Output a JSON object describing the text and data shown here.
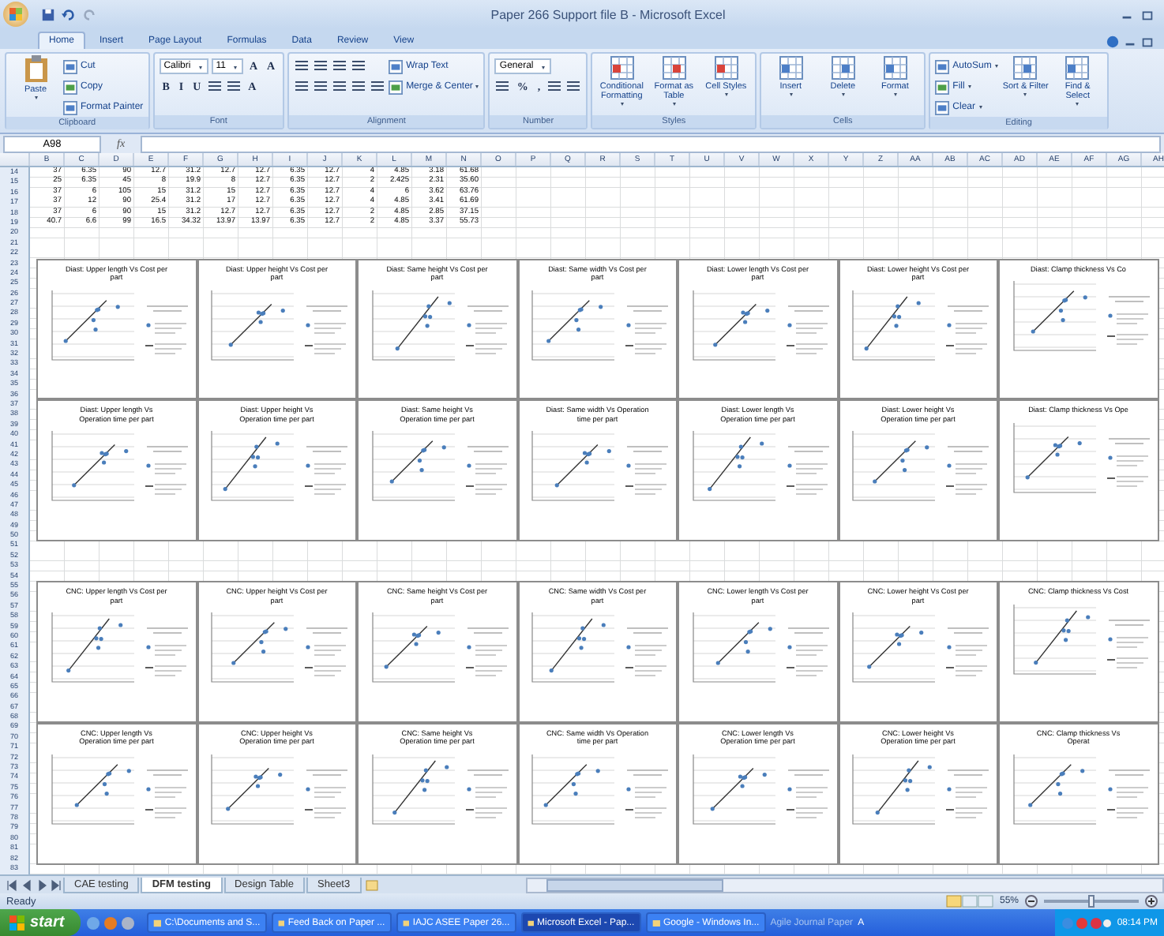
{
  "window": {
    "title": "Paper 266 Support file B - Microsoft Excel"
  },
  "ribbon": {
    "tabs": [
      {
        "label": "Home",
        "selected": true
      },
      {
        "label": "Insert",
        "selected": false
      },
      {
        "label": "Page Layout",
        "selected": false
      },
      {
        "label": "Formulas",
        "selected": false
      },
      {
        "label": "Data",
        "selected": false
      },
      {
        "label": "Review",
        "selected": false
      },
      {
        "label": "View",
        "selected": false
      }
    ],
    "groups": [
      {
        "label": "Clipboard",
        "items": [
          {
            "kind": "large",
            "label": "Paste",
            "dropdown": true
          },
          {
            "kind": "stack",
            "rows": [
              {
                "controls": [
                  {
                    "kind": "small",
                    "label": "Cut"
                  }
                ]
              },
              {
                "controls": [
                  {
                    "kind": "small",
                    "label": "Copy"
                  }
                ]
              },
              {
                "controls": [
                  {
                    "kind": "small",
                    "label": "Format Painter"
                  }
                ]
              }
            ]
          }
        ]
      },
      {
        "label": "Font",
        "items": [
          {
            "kind": "stack",
            "rows": [
              {
                "controls": [
                  {
                    "kind": "field",
                    "label": "Calibri"
                  },
                  {
                    "kind": "field",
                    "label": "11"
                  },
                  {
                    "kind": "glyph",
                    "label": "A"
                  },
                  {
                    "kind": "glyph",
                    "label": "A"
                  }
                ]
              },
              {
                "controls": [
                  {
                    "kind": "glyph",
                    "label": "B"
                  },
                  {
                    "kind": "glyph",
                    "label": "I"
                  },
                  {
                    "kind": "glyph",
                    "label": "U"
                  },
                  {
                    "kind": "icon"
                  },
                  {
                    "kind": "icon"
                  },
                  {
                    "kind": "glyph",
                    "label": "A"
                  }
                ]
              }
            ]
          }
        ]
      },
      {
        "label": "Alignment",
        "items": [
          {
            "kind": "stack",
            "rows": [
              {
                "controls": [
                  {
                    "kind": "icon"
                  },
                  {
                    "kind": "icon"
                  },
                  {
                    "kind": "icon"
                  },
                  {
                    "kind": "icon"
                  }
                ]
              },
              {
                "controls": [
                  {
                    "kind": "icon"
                  },
                  {
                    "kind": "icon"
                  },
                  {
                    "kind": "icon"
                  },
                  {
                    "kind": "icon"
                  },
                  {
                    "kind": "icon"
                  }
                ]
              }
            ]
          },
          {
            "kind": "stack",
            "rows": [
              {
                "controls": [
                  {
                    "kind": "small",
                    "label": "Wrap Text"
                  }
                ]
              },
              {
                "controls": [
                  {
                    "kind": "small",
                    "label": "Merge & Center",
                    "dropdown": true
                  }
                ]
              }
            ]
          }
        ]
      },
      {
        "label": "Number",
        "items": [
          {
            "kind": "stack",
            "rows": [
              {
                "controls": [
                  {
                    "kind": "field",
                    "label": "General"
                  }
                ]
              },
              {
                "controls": [
                  {
                    "kind": "icon"
                  },
                  {
                    "kind": "glyph",
                    "label": "%"
                  },
                  {
                    "kind": "glyph",
                    "label": ","
                  },
                  {
                    "kind": "icon"
                  },
                  {
                    "kind": "icon"
                  }
                ]
              }
            ]
          }
        ]
      },
      {
        "label": "Styles",
        "items": [
          {
            "kind": "large",
            "label": "Conditional Formatting",
            "dropdown": true
          },
          {
            "kind": "large",
            "label": "Format as Table",
            "dropdown": true
          },
          {
            "kind": "large",
            "label": "Cell Styles",
            "dropdown": true
          }
        ]
      },
      {
        "label": "Cells",
        "items": [
          {
            "kind": "large",
            "label": "Insert",
            "dropdown": true
          },
          {
            "kind": "large",
            "label": "Delete",
            "dropdown": true
          },
          {
            "kind": "large",
            "label": "Format",
            "dropdown": true
          }
        ]
      },
      {
        "label": "Editing",
        "items": [
          {
            "kind": "stack",
            "rows": [
              {
                "controls": [
                  {
                    "kind": "small",
                    "label": "AutoSum",
                    "dropdown": true
                  }
                ]
              },
              {
                "controls": [
                  {
                    "kind": "small",
                    "label": "Fill",
                    "dropdown": true
                  }
                ]
              },
              {
                "controls": [
                  {
                    "kind": "small",
                    "label": "Clear",
                    "dropdown": true
                  }
                ]
              }
            ]
          },
          {
            "kind": "large",
            "label": "Sort & Filter",
            "dropdown": true
          },
          {
            "kind": "large",
            "label": "Find & Select",
            "dropdown": true
          }
        ]
      }
    ]
  },
  "formula_bar": {
    "name_box": "A98",
    "function_label": "fx"
  },
  "sheet": {
    "columns": [
      "B",
      "C",
      "D",
      "E",
      "F",
      "G",
      "H",
      "I",
      "J",
      "K",
      "L",
      "M",
      "N",
      "O",
      "P",
      "Q",
      "R",
      "S",
      "T",
      "U",
      "V",
      "W",
      "X",
      "Y",
      "Z",
      "AA",
      "AB",
      "AC",
      "AD",
      "AE",
      "AF",
      "AG",
      "AH"
    ],
    "row_numbers": [
      "14",
      "15",
      "16",
      "17",
      "18",
      "19",
      "20",
      "21",
      "22",
      "23",
      "24",
      "25",
      "26",
      "27",
      "28",
      "29",
      "30",
      "31",
      "32",
      "33",
      "34",
      "35",
      "36",
      "37",
      "38",
      "39",
      "40",
      "41",
      "42",
      "43",
      "44",
      "45",
      "46",
      "47",
      "48",
      "49",
      "50",
      "51",
      "52",
      "53",
      "54",
      "55",
      "56",
      "57",
      "58",
      "59",
      "60",
      "61",
      "62",
      "63",
      "64",
      "65",
      "66",
      "67",
      "68",
      "69",
      "70",
      "71",
      "72",
      "73",
      "74",
      "75",
      "76",
      "77",
      "78",
      "79",
      "80",
      "81",
      "82",
      "83"
    ],
    "rows": [
      [
        "37",
        "6.35",
        "90",
        "12.7",
        "31.2",
        "12.7",
        "12.7",
        "6.35",
        "12.7",
        "4",
        "4.85",
        "3.18",
        "61.68"
      ],
      [
        "25",
        "6.35",
        "45",
        "8",
        "19.9",
        "8",
        "12.7",
        "6.35",
        "12.7",
        "2",
        "2.425",
        "2.31",
        "35.60"
      ],
      [
        "37",
        "6",
        "105",
        "15",
        "31.2",
        "15",
        "12.7",
        "6.35",
        "12.7",
        "4",
        "6",
        "3.62",
        "63.76"
      ],
      [
        "37",
        "12",
        "90",
        "25.4",
        "31.2",
        "17",
        "12.7",
        "6.35",
        "12.7",
        "4",
        "4.85",
        "3.41",
        "61.69"
      ],
      [
        "37",
        "6",
        "90",
        "15",
        "31.2",
        "12.7",
        "12.7",
        "6.35",
        "12.7",
        "2",
        "4.85",
        "2.85",
        "37.15"
      ],
      [
        "40.7",
        "6.6",
        "99",
        "16.5",
        "34.32",
        "13.97",
        "13.97",
        "6.35",
        "12.7",
        "2",
        "4.85",
        "3.37",
        "55.73"
      ]
    ]
  },
  "chart_rows": [
    {
      "charts": [
        {
          "title": "Diast: Upper length Vs Cost per part"
        },
        {
          "title": "Diast: Upper height Vs Cost per part"
        },
        {
          "title": "Diast: Same height Vs Cost per part"
        },
        {
          "title": "Diast: Same width Vs Cost per part"
        },
        {
          "title": "Diast: Lower length Vs Cost per part"
        },
        {
          "title": "Diast: Lower height Vs Cost per part"
        },
        {
          "title": "Diast: Clamp thickness Vs Co"
        }
      ]
    },
    {
      "charts": [
        {
          "title": "Diast: Upper length Vs Operation time per part"
        },
        {
          "title": "Diast: Upper height Vs Operation time per part"
        },
        {
          "title": "Diast: Same height Vs Operation time per part"
        },
        {
          "title": "Diast: Same width Vs Operation time per part"
        },
        {
          "title": "Diast: Lower length Vs Operation time per part"
        },
        {
          "title": "Diast: Lower height Vs Operation time per part"
        },
        {
          "title": "Diast: Clamp thickness Vs Ope"
        }
      ]
    },
    {
      "charts": [
        {
          "title": "CNC: Upper length Vs Cost per part"
        },
        {
          "title": "CNC: Upper height Vs Cost per part"
        },
        {
          "title": "CNC: Same height Vs Cost per part"
        },
        {
          "title": "CNC: Same width Vs Cost per part"
        },
        {
          "title": "CNC: Lower length Vs Cost per part"
        },
        {
          "title": "CNC: Lower height Vs Cost per part"
        },
        {
          "title": "CNC: Clamp thickness Vs Cost"
        }
      ]
    },
    {
      "charts": [
        {
          "title": "CNC: Upper length Vs Operation time per part"
        },
        {
          "title": "CNC: Upper height Vs Operation time per part"
        },
        {
          "title": "CNC: Same height Vs Operation time per part"
        },
        {
          "title": "CNC: Same width Vs Operation time per part"
        },
        {
          "title": "CNC: Lower length Vs Operation time per part"
        },
        {
          "title": "CNC: Lower height Vs Operation time per part"
        },
        {
          "title": "CNC: Clamp thickness Vs Operat"
        }
      ]
    }
  ],
  "sheet_tabs": [
    {
      "label": "CAE testing",
      "selected": false
    },
    {
      "label": "DFM testing",
      "selected": true
    },
    {
      "label": "Design Table",
      "selected": false
    },
    {
      "label": "Sheet3",
      "selected": false
    }
  ],
  "status_bar": {
    "text": "Ready",
    "zoom": "55%",
    "zoom_slider": {
      "level": 0.5
    }
  },
  "taskbar": {
    "start": "start",
    "tasks": [
      {
        "label": "C:\\Documents and S...",
        "selected": false
      },
      {
        "label": "Feed Back on Paper ...",
        "selected": false
      },
      {
        "label": "IAJC ASEE Paper 26...",
        "selected": false
      },
      {
        "label": "Microsoft Excel - Pap...",
        "selected": true
      },
      {
        "label": "Google - Windows In...",
        "selected": false
      }
    ],
    "deskband": "Agile Journal Paper",
    "toolbar_label": "A",
    "clock": "08:14 PM"
  }
}
